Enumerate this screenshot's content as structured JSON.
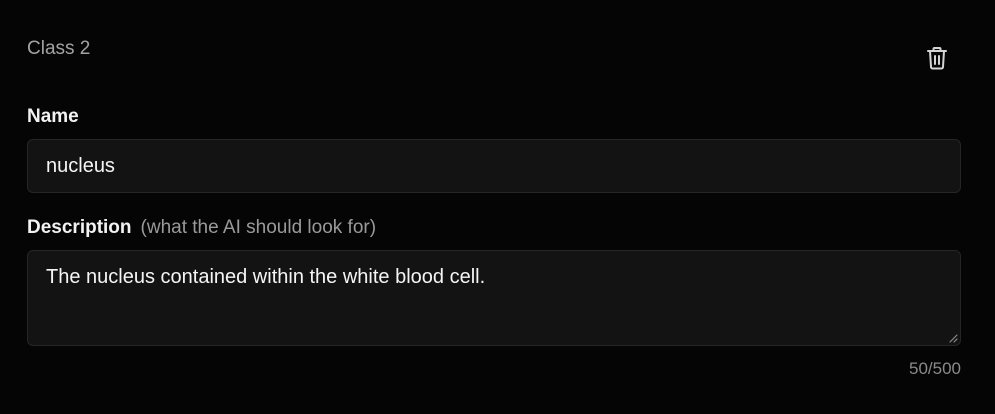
{
  "class_card": {
    "title": "Class 2",
    "delete_icon": "trash-icon"
  },
  "name_field": {
    "label": "Name",
    "value": "nucleus"
  },
  "description_field": {
    "label": "Description",
    "hint": "(what the AI should look for)",
    "value": "The nucleus contained within the white blood cell.",
    "counter": "50/500"
  },
  "colors": {
    "background": "#050505",
    "input_background": "#131313",
    "input_border": "#262626",
    "muted_text": "#a3a3a3"
  }
}
